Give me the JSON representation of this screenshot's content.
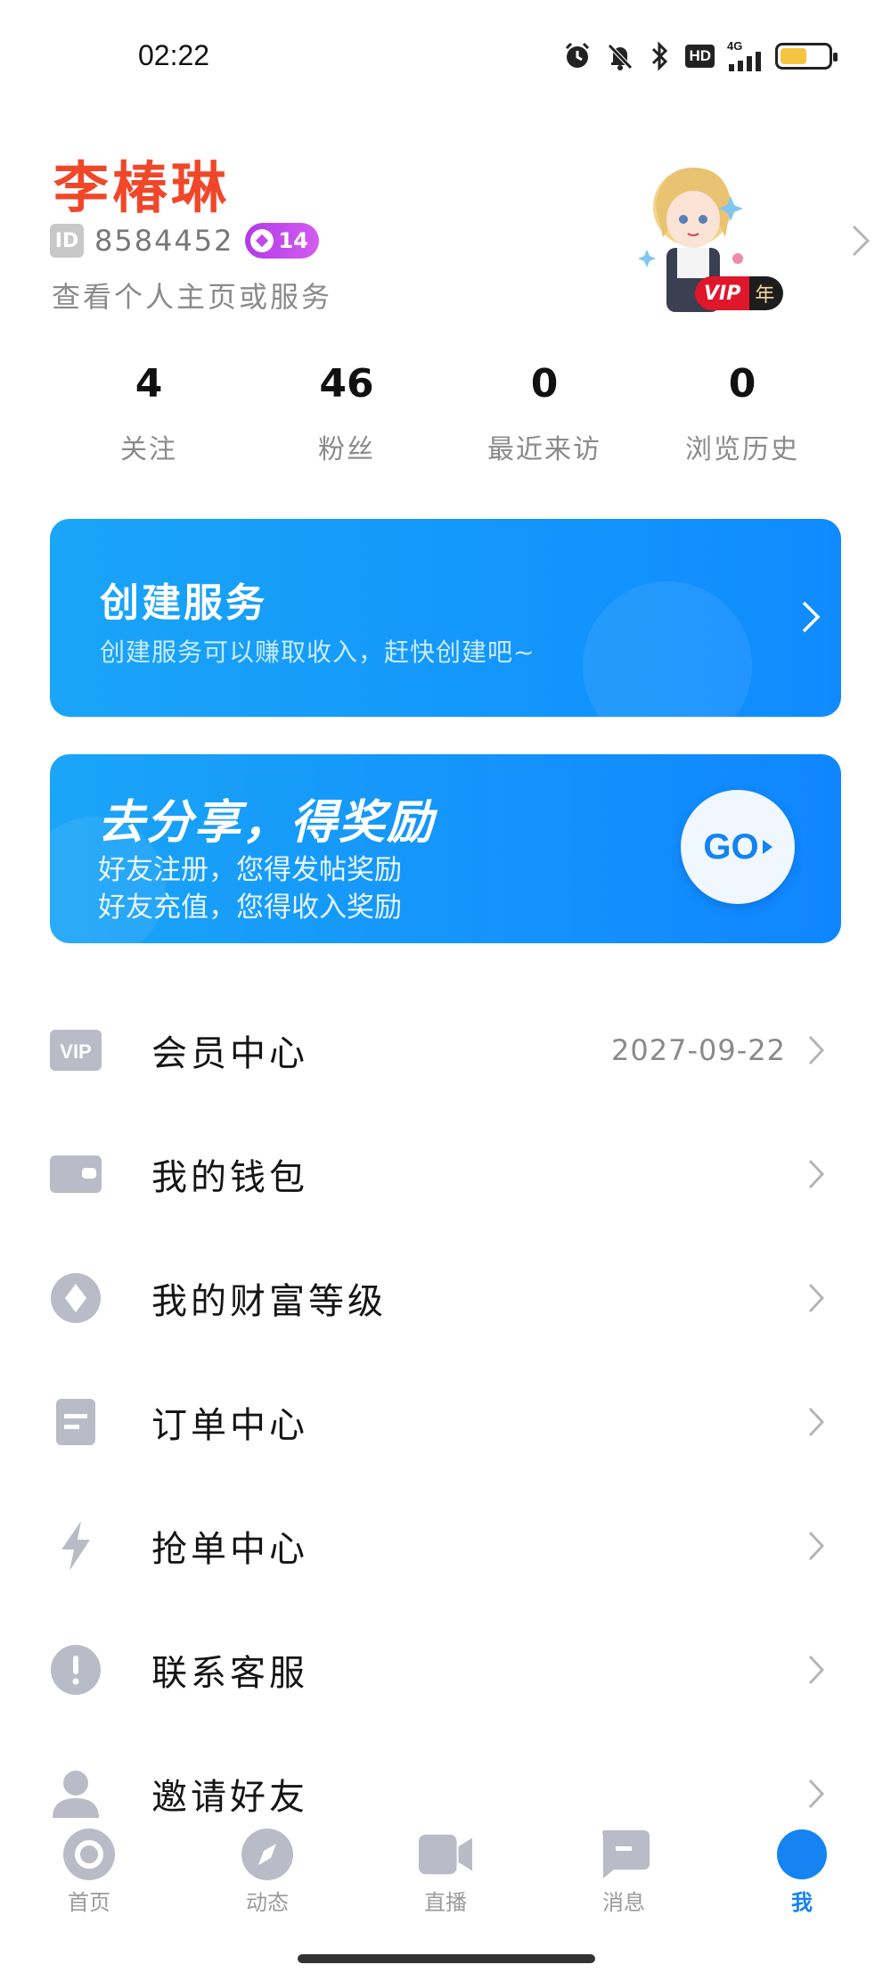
{
  "status_bar": {
    "time": "02:22",
    "network": "4G",
    "hd_label": "HD",
    "icons": [
      "alarm-icon",
      "mute-icon",
      "bluetooth-icon",
      "hd-icon",
      "signal-icon",
      "battery-icon"
    ]
  },
  "profile": {
    "name": "李椿琳",
    "id_label": "ID",
    "id_number": "8584452",
    "level": "14",
    "subtitle": "查看个人主页或服务",
    "vip_label": "VIP",
    "vip_term": "年"
  },
  "stats": [
    {
      "value": "4",
      "label": "关注"
    },
    {
      "value": "46",
      "label": "粉丝"
    },
    {
      "value": "0",
      "label": "最近来访"
    },
    {
      "value": "0",
      "label": "浏览历史"
    }
  ],
  "create_card": {
    "title": "创建服务",
    "subtitle": "创建服务可以赚取收入，赶快创建吧~"
  },
  "share_card": {
    "title": "去分享，得奖励",
    "line1": "好友注册，您得发帖奖励",
    "line2": "好友充值，您得收入奖励",
    "go_label": "GO"
  },
  "menu": [
    {
      "label": "会员中心",
      "value": "2027-09-22",
      "icon": "vip-icon"
    },
    {
      "label": "我的钱包",
      "value": "",
      "icon": "wallet-icon"
    },
    {
      "label": "我的财富等级",
      "value": "",
      "icon": "diamond-icon"
    },
    {
      "label": "订单中心",
      "value": "",
      "icon": "order-icon"
    },
    {
      "label": "抢单中心",
      "value": "",
      "icon": "lightning-icon"
    },
    {
      "label": "联系客服",
      "value": "",
      "icon": "alert-icon"
    },
    {
      "label": "邀请好友",
      "value": "",
      "icon": "user-icon"
    }
  ],
  "bottom_nav": [
    {
      "label": "首页",
      "icon": "home-icon"
    },
    {
      "label": "动态",
      "icon": "compass-icon"
    },
    {
      "label": "直播",
      "icon": "video-icon"
    },
    {
      "label": "消息",
      "icon": "message-icon"
    },
    {
      "label": "我",
      "icon": "me-icon",
      "active": true
    }
  ],
  "colors": {
    "accent": "#1583f2",
    "name_red": "#f0472a",
    "card_blue": "#1aa5f7",
    "level_purple": "#c148ec",
    "battery_yellow": "#f5c542"
  }
}
